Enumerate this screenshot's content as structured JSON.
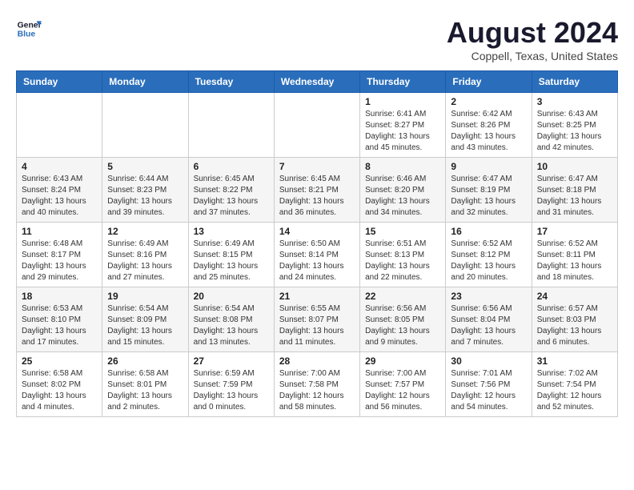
{
  "header": {
    "logo_text_general": "General",
    "logo_text_blue": "Blue",
    "main_title": "August 2024",
    "subtitle": "Coppell, Texas, United States"
  },
  "calendar": {
    "days_of_week": [
      "Sunday",
      "Monday",
      "Tuesday",
      "Wednesday",
      "Thursday",
      "Friday",
      "Saturday"
    ],
    "weeks": [
      [
        {
          "day": "",
          "info": ""
        },
        {
          "day": "",
          "info": ""
        },
        {
          "day": "",
          "info": ""
        },
        {
          "day": "",
          "info": ""
        },
        {
          "day": "1",
          "info": "Sunrise: 6:41 AM\nSunset: 8:27 PM\nDaylight: 13 hours\nand 45 minutes."
        },
        {
          "day": "2",
          "info": "Sunrise: 6:42 AM\nSunset: 8:26 PM\nDaylight: 13 hours\nand 43 minutes."
        },
        {
          "day": "3",
          "info": "Sunrise: 6:43 AM\nSunset: 8:25 PM\nDaylight: 13 hours\nand 42 minutes."
        }
      ],
      [
        {
          "day": "4",
          "info": "Sunrise: 6:43 AM\nSunset: 8:24 PM\nDaylight: 13 hours\nand 40 minutes."
        },
        {
          "day": "5",
          "info": "Sunrise: 6:44 AM\nSunset: 8:23 PM\nDaylight: 13 hours\nand 39 minutes."
        },
        {
          "day": "6",
          "info": "Sunrise: 6:45 AM\nSunset: 8:22 PM\nDaylight: 13 hours\nand 37 minutes."
        },
        {
          "day": "7",
          "info": "Sunrise: 6:45 AM\nSunset: 8:21 PM\nDaylight: 13 hours\nand 36 minutes."
        },
        {
          "day": "8",
          "info": "Sunrise: 6:46 AM\nSunset: 8:20 PM\nDaylight: 13 hours\nand 34 minutes."
        },
        {
          "day": "9",
          "info": "Sunrise: 6:47 AM\nSunset: 8:19 PM\nDaylight: 13 hours\nand 32 minutes."
        },
        {
          "day": "10",
          "info": "Sunrise: 6:47 AM\nSunset: 8:18 PM\nDaylight: 13 hours\nand 31 minutes."
        }
      ],
      [
        {
          "day": "11",
          "info": "Sunrise: 6:48 AM\nSunset: 8:17 PM\nDaylight: 13 hours\nand 29 minutes."
        },
        {
          "day": "12",
          "info": "Sunrise: 6:49 AM\nSunset: 8:16 PM\nDaylight: 13 hours\nand 27 minutes."
        },
        {
          "day": "13",
          "info": "Sunrise: 6:49 AM\nSunset: 8:15 PM\nDaylight: 13 hours\nand 25 minutes."
        },
        {
          "day": "14",
          "info": "Sunrise: 6:50 AM\nSunset: 8:14 PM\nDaylight: 13 hours\nand 24 minutes."
        },
        {
          "day": "15",
          "info": "Sunrise: 6:51 AM\nSunset: 8:13 PM\nDaylight: 13 hours\nand 22 minutes."
        },
        {
          "day": "16",
          "info": "Sunrise: 6:52 AM\nSunset: 8:12 PM\nDaylight: 13 hours\nand 20 minutes."
        },
        {
          "day": "17",
          "info": "Sunrise: 6:52 AM\nSunset: 8:11 PM\nDaylight: 13 hours\nand 18 minutes."
        }
      ],
      [
        {
          "day": "18",
          "info": "Sunrise: 6:53 AM\nSunset: 8:10 PM\nDaylight: 13 hours\nand 17 minutes."
        },
        {
          "day": "19",
          "info": "Sunrise: 6:54 AM\nSunset: 8:09 PM\nDaylight: 13 hours\nand 15 minutes."
        },
        {
          "day": "20",
          "info": "Sunrise: 6:54 AM\nSunset: 8:08 PM\nDaylight: 13 hours\nand 13 minutes."
        },
        {
          "day": "21",
          "info": "Sunrise: 6:55 AM\nSunset: 8:07 PM\nDaylight: 13 hours\nand 11 minutes."
        },
        {
          "day": "22",
          "info": "Sunrise: 6:56 AM\nSunset: 8:05 PM\nDaylight: 13 hours\nand 9 minutes."
        },
        {
          "day": "23",
          "info": "Sunrise: 6:56 AM\nSunset: 8:04 PM\nDaylight: 13 hours\nand 7 minutes."
        },
        {
          "day": "24",
          "info": "Sunrise: 6:57 AM\nSunset: 8:03 PM\nDaylight: 13 hours\nand 6 minutes."
        }
      ],
      [
        {
          "day": "25",
          "info": "Sunrise: 6:58 AM\nSunset: 8:02 PM\nDaylight: 13 hours\nand 4 minutes."
        },
        {
          "day": "26",
          "info": "Sunrise: 6:58 AM\nSunset: 8:01 PM\nDaylight: 13 hours\nand 2 minutes."
        },
        {
          "day": "27",
          "info": "Sunrise: 6:59 AM\nSunset: 7:59 PM\nDaylight: 13 hours\nand 0 minutes."
        },
        {
          "day": "28",
          "info": "Sunrise: 7:00 AM\nSunset: 7:58 PM\nDaylight: 12 hours\nand 58 minutes."
        },
        {
          "day": "29",
          "info": "Sunrise: 7:00 AM\nSunset: 7:57 PM\nDaylight: 12 hours\nand 56 minutes."
        },
        {
          "day": "30",
          "info": "Sunrise: 7:01 AM\nSunset: 7:56 PM\nDaylight: 12 hours\nand 54 minutes."
        },
        {
          "day": "31",
          "info": "Sunrise: 7:02 AM\nSunset: 7:54 PM\nDaylight: 12 hours\nand 52 minutes."
        }
      ]
    ]
  }
}
